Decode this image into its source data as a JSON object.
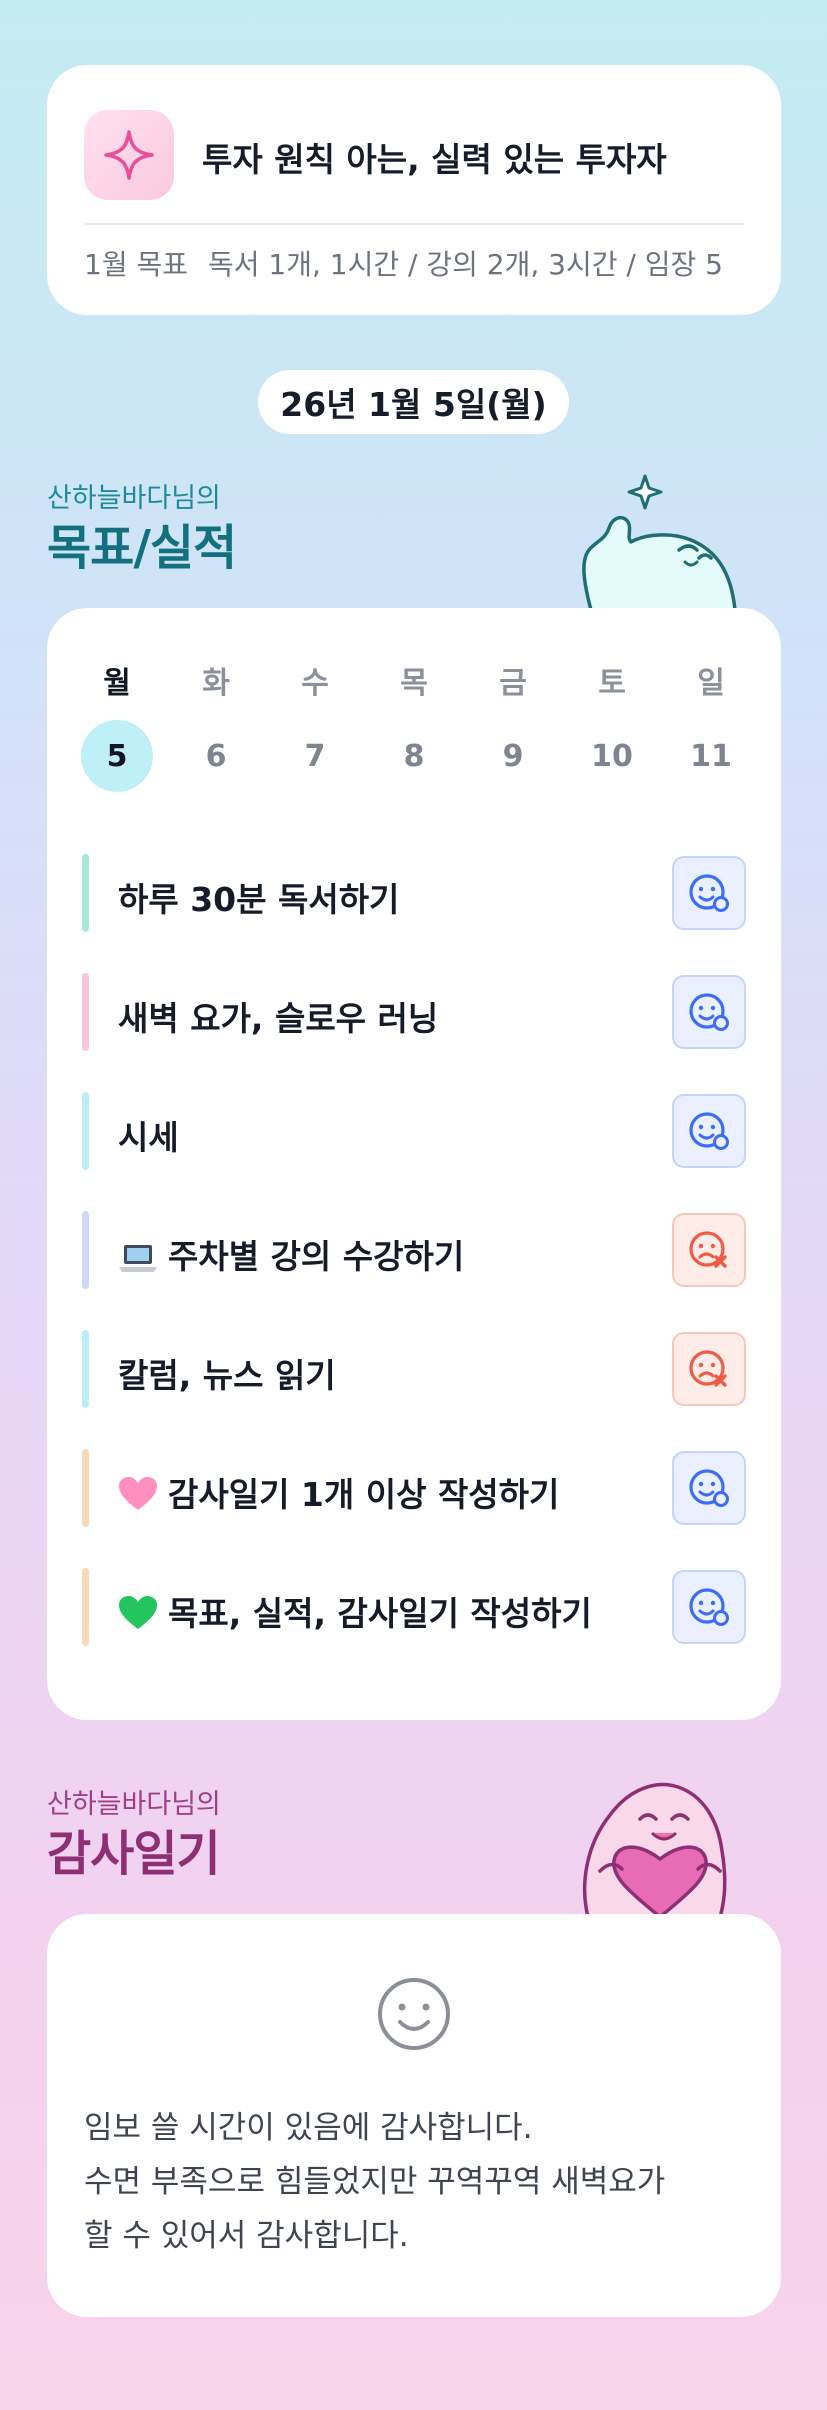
{
  "goal": {
    "icon": "sparkle-icon",
    "title": "투자 원칙 아는, 실력 있는 투자자",
    "monthly_label": "1월 목표",
    "monthly_text": "독서 1개, 1시간 / 강의 2개, 3시간 / 임장 5"
  },
  "date": "26년 1월 5일(월)",
  "goals_section": {
    "subtitle": "산하늘바다님의",
    "title": "목표/실적"
  },
  "week": {
    "days": [
      {
        "dow": "월",
        "num": "5",
        "active": true
      },
      {
        "dow": "화",
        "num": "6"
      },
      {
        "dow": "수",
        "num": "7"
      },
      {
        "dow": "목",
        "num": "8"
      },
      {
        "dow": "금",
        "num": "9"
      },
      {
        "dow": "토",
        "num": "10"
      },
      {
        "dow": "일",
        "num": "11"
      }
    ]
  },
  "tasks": [
    {
      "label": "하루 30분 독서하기",
      "bar_color": "#a7ead6",
      "status": "done",
      "icon": ""
    },
    {
      "label": "새벽 요가, 슬로우 러닝",
      "bar_color": "#fbc4dc",
      "status": "done",
      "icon": ""
    },
    {
      "label": "시세",
      "bar_color": "#b9eef4",
      "status": "done",
      "icon": ""
    },
    {
      "label": "주차별 강의 수강하기",
      "bar_color": "#cdd9f7",
      "status": "missed",
      "icon": "laptop-icon"
    },
    {
      "label": "칼럼, 뉴스 읽기",
      "bar_color": "#b9eef4",
      "status": "missed",
      "icon": ""
    },
    {
      "label": "감사일기 1개 이상 작성하기",
      "bar_color": "#fbd9b7",
      "status": "done",
      "icon": "pink-heart-icon"
    },
    {
      "label": "목표, 실적, 감사일기 작성하기",
      "bar_color": "#fbd9b7",
      "status": "done",
      "icon": "green-heart-icon"
    }
  ],
  "gratitude_section": {
    "subtitle": "산하늘바다님의",
    "title": "감사일기"
  },
  "gratitude": {
    "icon": "smile-icon",
    "lines": [
      "임보 쓸 시간이 있음에 감사합니다.",
      "수면 부족으로 힘들었지만 꾸역꾸역 새벽요가",
      "할 수 있어서 감사합니다."
    ]
  },
  "colors": {
    "ok_icon": "#3d6df5",
    "missed_icon": "#ef5b45",
    "goals_title": "#12707f",
    "gratitude_title": "#8e2f73"
  }
}
